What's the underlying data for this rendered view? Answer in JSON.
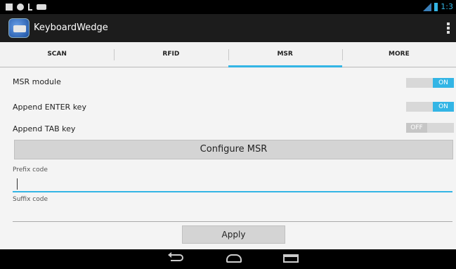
{
  "status_bar": {
    "time": "1:3",
    "icons": [
      "notification-icon",
      "globe-icon",
      "usb-icon",
      "message-icon",
      "signal-icon",
      "battery-icon"
    ]
  },
  "app": {
    "title": "KeyboardWedge",
    "icon": "keyboard-app-icon"
  },
  "tabs": [
    {
      "label": "SCAN",
      "selected": false
    },
    {
      "label": "RFID",
      "selected": false
    },
    {
      "label": "MSR",
      "selected": true
    },
    {
      "label": "MORE",
      "selected": false
    }
  ],
  "settings": {
    "msr_module": {
      "label": "MSR module",
      "state": "ON"
    },
    "append_enter": {
      "label": "Append ENTER key",
      "state": "ON"
    },
    "append_tab": {
      "label": "Append TAB key",
      "state": "OFF"
    }
  },
  "configure_button": "Configure MSR",
  "prefix": {
    "label": "Prefix code",
    "value": ""
  },
  "suffix": {
    "label": "Suffix code",
    "value": ""
  },
  "apply_button": "Apply",
  "colors": {
    "accent": "#33b5e5",
    "action_bar": "#1c1c1c",
    "background": "#f4f4f4"
  }
}
